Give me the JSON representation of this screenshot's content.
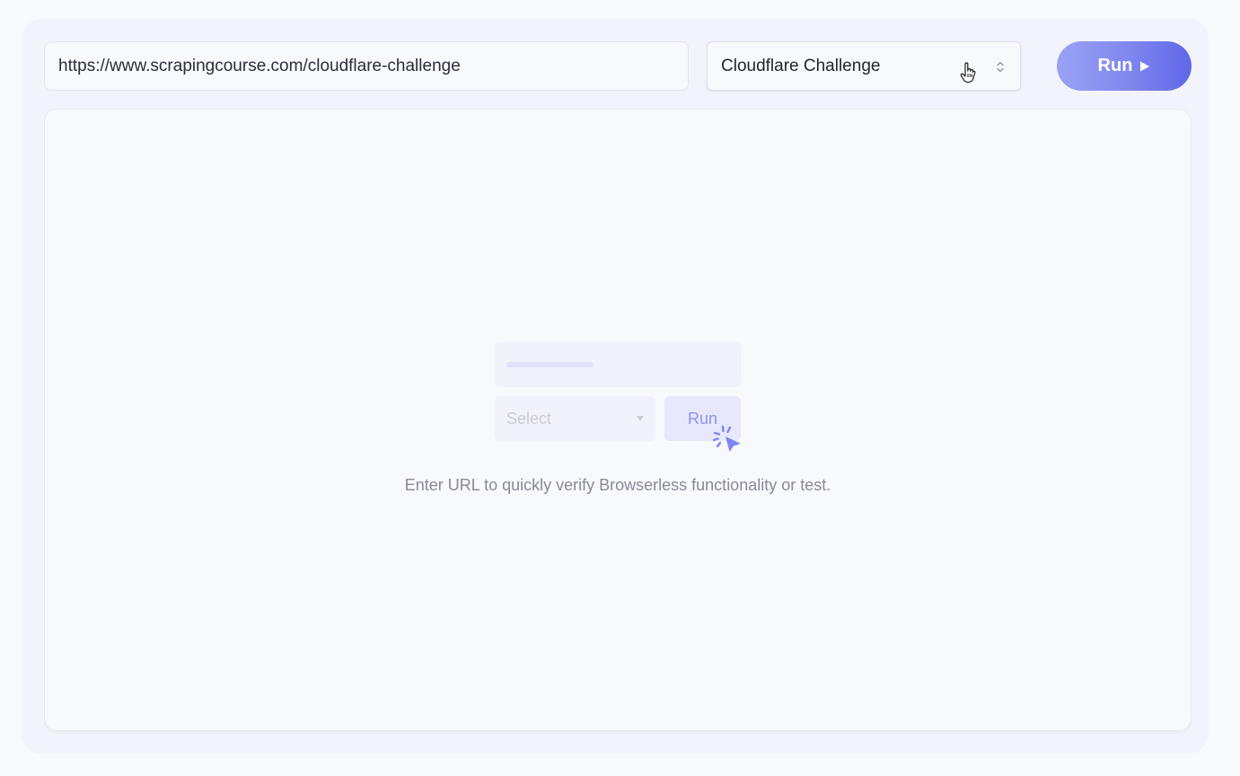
{
  "toolbar": {
    "url_value": "https://www.scrapingcourse.com/cloudflare-challenge",
    "select_value": "Cloudflare Challenge",
    "run_label": "Run"
  },
  "empty_state": {
    "illustration_select_label": "Select",
    "illustration_run_label": "Run",
    "hint": "Enter URL to quickly verify Browserless functionality or test."
  },
  "colors": {
    "accent": "#6067e8",
    "accent_light": "#9aa2f4",
    "background": "#f8f9fc",
    "hint_text": "#878a99"
  },
  "icons": {
    "cursor": "hand-pointer-icon",
    "select_arrows": "updown-chevron-icon",
    "run": "play-icon",
    "illustration_click": "click-cursor-icon"
  }
}
